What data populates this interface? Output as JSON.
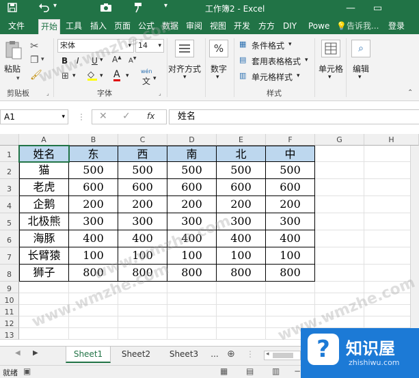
{
  "window": {
    "title": "工作簿2 - Excel",
    "restore_glyph": "▭"
  },
  "tabs": [
    "文件",
    "开始",
    "工具",
    "插入",
    "页面",
    "公式",
    "数据",
    "审阅",
    "视图",
    "开发",
    "方方",
    "DIY",
    "Powe",
    "告诉我...",
    "登录"
  ],
  "ribbon": {
    "clipboard": {
      "paste": "粘贴",
      "label": "剪贴板"
    },
    "font": {
      "name": "宋体",
      "size": "14",
      "bold": "B",
      "italic": "I",
      "underline": "U",
      "font_color_letter": "A",
      "wen": "wén",
      "label": "字体"
    },
    "alignment": {
      "label": "对齐方式"
    },
    "number": {
      "symbol": "%",
      "label": "数字"
    },
    "styles": {
      "conditional": "条件格式",
      "table": "套用表格格式",
      "cell": "单元格样式",
      "label": "样式"
    },
    "cells": {
      "label": "单元格"
    },
    "editing": {
      "label": "编辑"
    }
  },
  "formula_bar": {
    "name_box": "A1",
    "fx": "fx",
    "value": "姓名"
  },
  "columns": [
    "A",
    "B",
    "C",
    "D",
    "E",
    "F",
    "G",
    "H"
  ],
  "rows": [
    "1",
    "2",
    "3",
    "4",
    "5",
    "6",
    "7",
    "8",
    "9",
    "10",
    "11",
    "12",
    "13"
  ],
  "table": {
    "header": [
      "姓名",
      "东",
      "西",
      "南",
      "北",
      "中"
    ],
    "body": [
      [
        "猫",
        "500",
        "500",
        "500",
        "500",
        "500"
      ],
      [
        "老虎",
        "600",
        "600",
        "600",
        "600",
        "600"
      ],
      [
        "企鹅",
        "200",
        "200",
        "200",
        "200",
        "200"
      ],
      [
        "北极熊",
        "300",
        "300",
        "300",
        "300",
        "300"
      ],
      [
        "海豚",
        "400",
        "400",
        "400",
        "400",
        "400"
      ],
      [
        "长臂猿",
        "100",
        "100",
        "100",
        "100",
        "100"
      ],
      [
        "狮子",
        "800",
        "800",
        "800",
        "800",
        "800"
      ]
    ]
  },
  "sheets": [
    "Sheet1",
    "Sheet2",
    "Sheet3"
  ],
  "sheet_more": "...",
  "status": {
    "ready": "就绪"
  },
  "watermark": {
    "text": "www.wmzhe.com",
    "logo_name": "知识屋",
    "logo_sub": "zhishiwu.com"
  },
  "colors": {
    "accent": "#217346",
    "header_fill": "#bdd7ee"
  }
}
